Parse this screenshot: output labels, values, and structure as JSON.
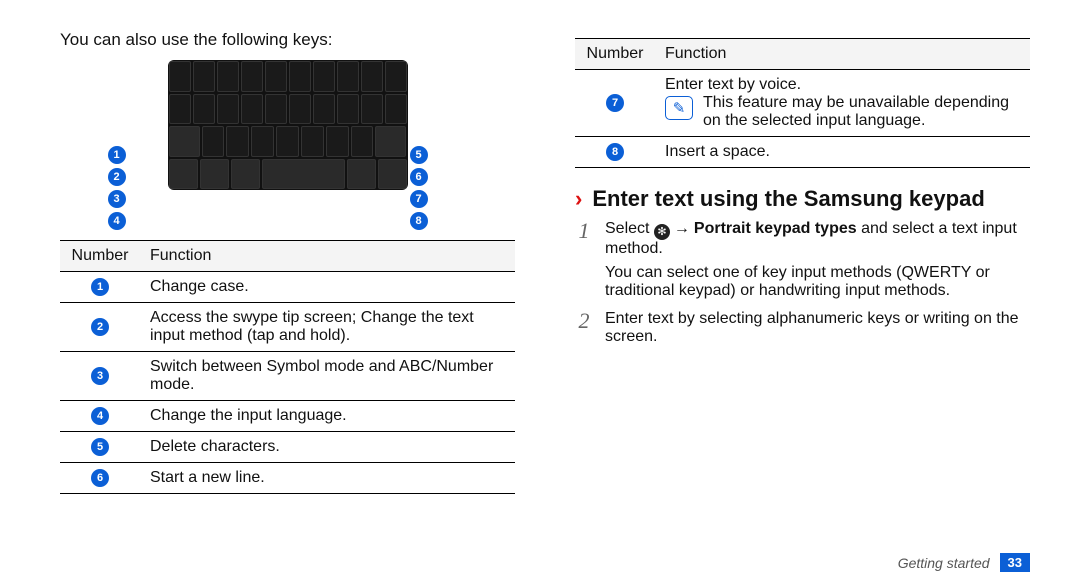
{
  "left": {
    "intro": "You can also use the following keys:",
    "table": {
      "head_number": "Number",
      "head_function": "Function",
      "rows": [
        {
          "n": "1",
          "fn": "Change case."
        },
        {
          "n": "2",
          "fn": "Access the swype tip screen; Change the text input method (tap and hold)."
        },
        {
          "n": "3",
          "fn": "Switch between Symbol mode and ABC/Number mode."
        },
        {
          "n": "4",
          "fn": "Change the input language."
        },
        {
          "n": "5",
          "fn": "Delete characters."
        },
        {
          "n": "6",
          "fn": "Start a new line."
        }
      ]
    },
    "callout_numbers_left": [
      "1",
      "2",
      "3",
      "4"
    ],
    "callout_numbers_right": [
      "5",
      "6",
      "7",
      "8"
    ]
  },
  "right": {
    "table": {
      "head_number": "Number",
      "head_function": "Function",
      "row7_n": "7",
      "row7_line1": "Enter text by voice.",
      "row7_note": "This feature may be unavailable depending on the selected input language.",
      "row8_n": "8",
      "row8_fn": "Insert a space."
    },
    "section_title": "Enter text using the Samsung keypad",
    "step1_n": "1",
    "step1_prefix": "Select ",
    "step1_bold": "Portrait keypad types",
    "step1_suffix": " and select a text input method.",
    "step1_p2": "You can select one of key input methods (QWERTY or traditional keypad) or handwriting input methods.",
    "step2_n": "2",
    "step2_txt": "Enter text by selecting alphanumeric keys or writing on the screen.",
    "arrow": "→"
  },
  "footer": {
    "section": "Getting started",
    "page": "33"
  },
  "icons": {
    "gear": "✻",
    "note": "✎",
    "chev": "›"
  }
}
